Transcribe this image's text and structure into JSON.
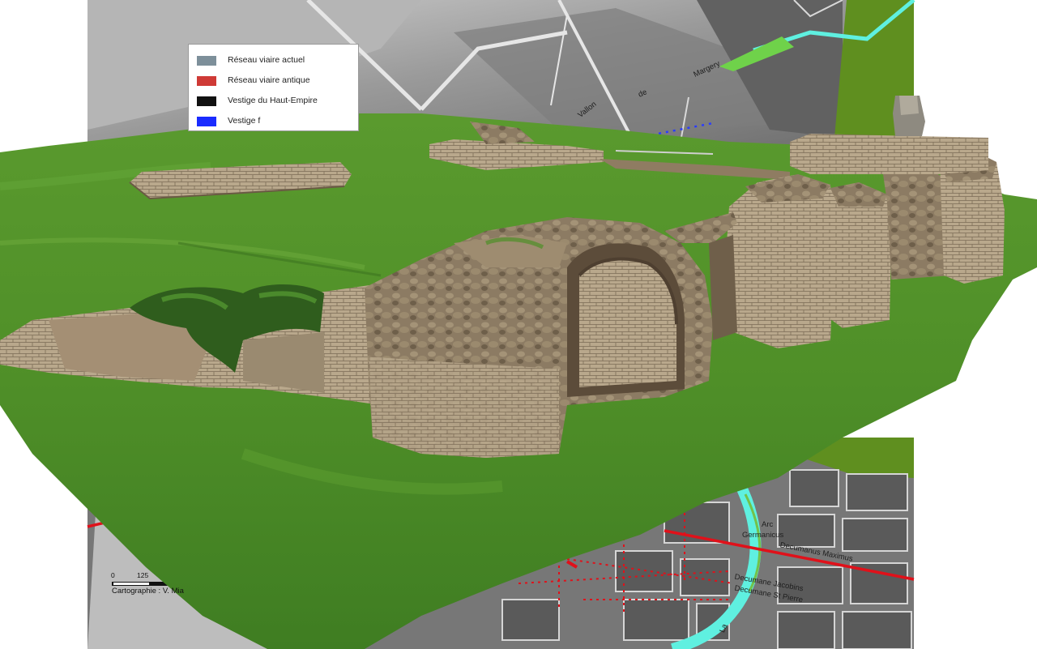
{
  "legend": {
    "items": [
      {
        "label": "Réseau viaire actuel",
        "color": "#7d8f9a"
      },
      {
        "label": "Réseau viaire antique",
        "color": "#cf3a36"
      },
      {
        "label": "Vestige du Haut-Empire",
        "color": "#111111"
      },
      {
        "label": "Vestige f",
        "color": "#1a2cff"
      }
    ]
  },
  "map_labels": {
    "vallon": "Vallon",
    "de": "de",
    "margery": "Margery",
    "arc": "Arc",
    "germanicus": "Germanicus",
    "decumanus_maximus": "Decumanus Maximus",
    "decumane_jacobins": "Decumane Jacobins",
    "decumane_st_pierre": "Decumane St Pierre",
    "la": "La"
  },
  "scale": {
    "zero": "0",
    "tick": "125"
  },
  "credit": "Cartographie : V. Mia",
  "colors": {
    "terrain_light": "#c9c9c9",
    "terrain_dark": "#6e6e6e",
    "road_modern": "#e3e3e3",
    "road_ancient": "#e0111a",
    "river": "#5ff0e0",
    "vegetation": "#5f8f1f",
    "grass": "#4e8a2a",
    "stone": "#8f7c62"
  },
  "icons": [
    "scale-bar-icon"
  ]
}
